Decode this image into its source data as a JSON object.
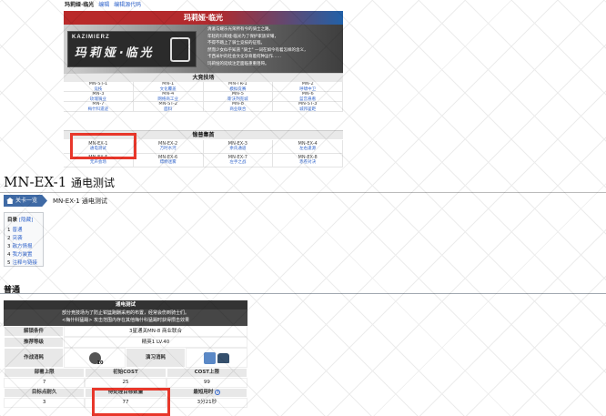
{
  "top": {
    "page_name": "玛莉娅·临光",
    "edit_link": "编辑",
    "edit_source_link": "编辑源代码",
    "title": "玛莉娅·临光",
    "logo_line1": "KAZIMIERZ",
    "logo_line2": "玛莉娅·临光",
    "description": [
      "清澈与耀乐光荣所有今的骑士之路。",
      "年轻的玛莉娅·临光为了保护家族荣耀，",
      "不得不踏上了骑士竞技的征程。",
      "然而少女似乎知道 \"骑士\" 一词在如今有着怎样的含义，",
      "卡西米尔的社会文化孕育着何种运作……",
      "玛莉娅的延续注定面临重重阻碍。"
    ],
    "section_main": "大竞技场",
    "main_levels": [
      {
        "code": "MN-ST-1",
        "name": "竞技"
      },
      {
        "code": "MN-1",
        "name": "文化覆盖"
      },
      {
        "code": "MN-TR-1",
        "name": "模拟竞赛"
      },
      {
        "code": "MN-2",
        "name": "呼啸中卫"
      },
      {
        "code": "MN-3",
        "name": "玫瑰骑业"
      },
      {
        "code": "MN-4",
        "name": "网络商工业"
      },
      {
        "code": "MN-5",
        "name": "斯沃列克城"
      },
      {
        "code": "MN-6",
        "name": "蓝宫悬看"
      },
      {
        "code": "MN-7",
        "name": "梅什科遗迹"
      },
      {
        "code": "MN-ST-2",
        "name": "面料"
      },
      {
        "code": "MN-8",
        "name": "商业联合"
      },
      {
        "code": "MN-ST-3",
        "name": "城邦差距"
      }
    ],
    "section_ex": "锻普集首",
    "ex_levels": [
      {
        "code": "MN-EX-1",
        "name": "通电测试"
      },
      {
        "code": "MN-EX-2",
        "name": "万时水河"
      },
      {
        "code": "MN-EX-3",
        "name": "余氏通道"
      },
      {
        "code": "MN-EX-4",
        "name": "左右逢源"
      },
      {
        "code": "MN-EX-5",
        "name": "无声会场"
      },
      {
        "code": "MN-EX-6",
        "name": "缥缈迷雾"
      },
      {
        "code": "MN-EX-7",
        "name": "左手之战"
      },
      {
        "code": "MN-EX-8",
        "name": "赤卷对决"
      }
    ]
  },
  "main": {
    "title_main": "MN-EX-1",
    "title_sub": "通电测试",
    "breadcrumb_home": "关卡一览",
    "breadcrumb_current": "MN-EX-1 通电测试",
    "toc": {
      "label": "目录",
      "toggle": "[隐藏]",
      "items": [
        {
          "num": "1",
          "label": "普通"
        },
        {
          "num": "2",
          "label": "突袭"
        },
        {
          "num": "3",
          "label": "敌方情报"
        },
        {
          "num": "4",
          "label": "我方装置"
        },
        {
          "num": "5",
          "label": "注释与链接"
        }
      ]
    },
    "section_heading": "普通",
    "stage": {
      "name": "通电测试",
      "description_1": "部分竞技场为了防止钳篮跑酬采用的布置，经常会伤到骑士们。",
      "description_2": "<梅什科猛踢> 攻击范围内存在其他梅什科猛踢时获得攒击效果",
      "unlock_label": "解锁条件",
      "unlock_value": "3星通关MN-8 商业联合",
      "level_label": "推荐等级",
      "level_value": "精英1 LV.40",
      "sanity_label": "作战消耗",
      "sanity_value": "10",
      "practice_label": "演习消耗",
      "deploy_label": "部署上限",
      "deploy_value": "7",
      "initcost_label": "初始COST",
      "initcost_value": "25",
      "maxcost_label": "COST上限",
      "maxcost_value": "99",
      "hp_label": "目标点耐久",
      "hp_value": "3",
      "enemy_count_label": "待处理目标数量",
      "enemy_count_value": "77",
      "time_label": "最短用时",
      "time_value": "3分21秒"
    }
  },
  "colors": {
    "accent_red": "#e8372b",
    "link_blue": "#3366cc",
    "breadcrumb_blue": "#3f6aa5",
    "title_gradient_red": "#ba2a2a",
    "title_gradient_blue": "#2161a8"
  }
}
